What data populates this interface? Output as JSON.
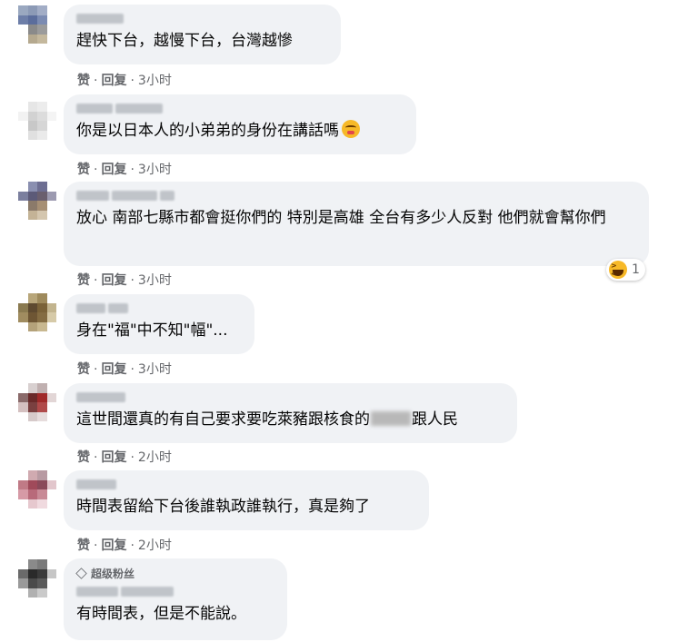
{
  "actions": {
    "like": "赞",
    "reply": "回复",
    "sep": "·"
  },
  "colors": {
    "bubble": "#f0f2f5",
    "meta": "#65676b",
    "text": "#050505"
  },
  "comments": [
    {
      "text": "趕快下台，越慢下台，台灣越慘",
      "time": "3小时"
    },
    {
      "text": "你是以日本人的小弟弟的身份在講話嗎",
      "emoji": "unamused-face",
      "time": "3小时"
    },
    {
      "text": "放心 南部七縣市都會挺你們的 特別是高雄 全台有多少人反對 他們就會幫你們",
      "time": "3小时",
      "reaction": {
        "icon": "laughing-face",
        "count": "1"
      }
    },
    {
      "text": "身在\"福\"中不知\"幅\"...",
      "time": "3小时"
    },
    {
      "text_before": "這世間還真的有自己要求要吃萊豬跟核食的",
      "text_after": "跟人民",
      "time": "2小时"
    },
    {
      "text": "時間表留給下台後誰執政誰執行，真是夠了",
      "time": "2小时"
    },
    {
      "badge": "超级粉丝",
      "badge_icon": "diamond-icon",
      "text": "有時間表，但是不能說。"
    }
  ]
}
